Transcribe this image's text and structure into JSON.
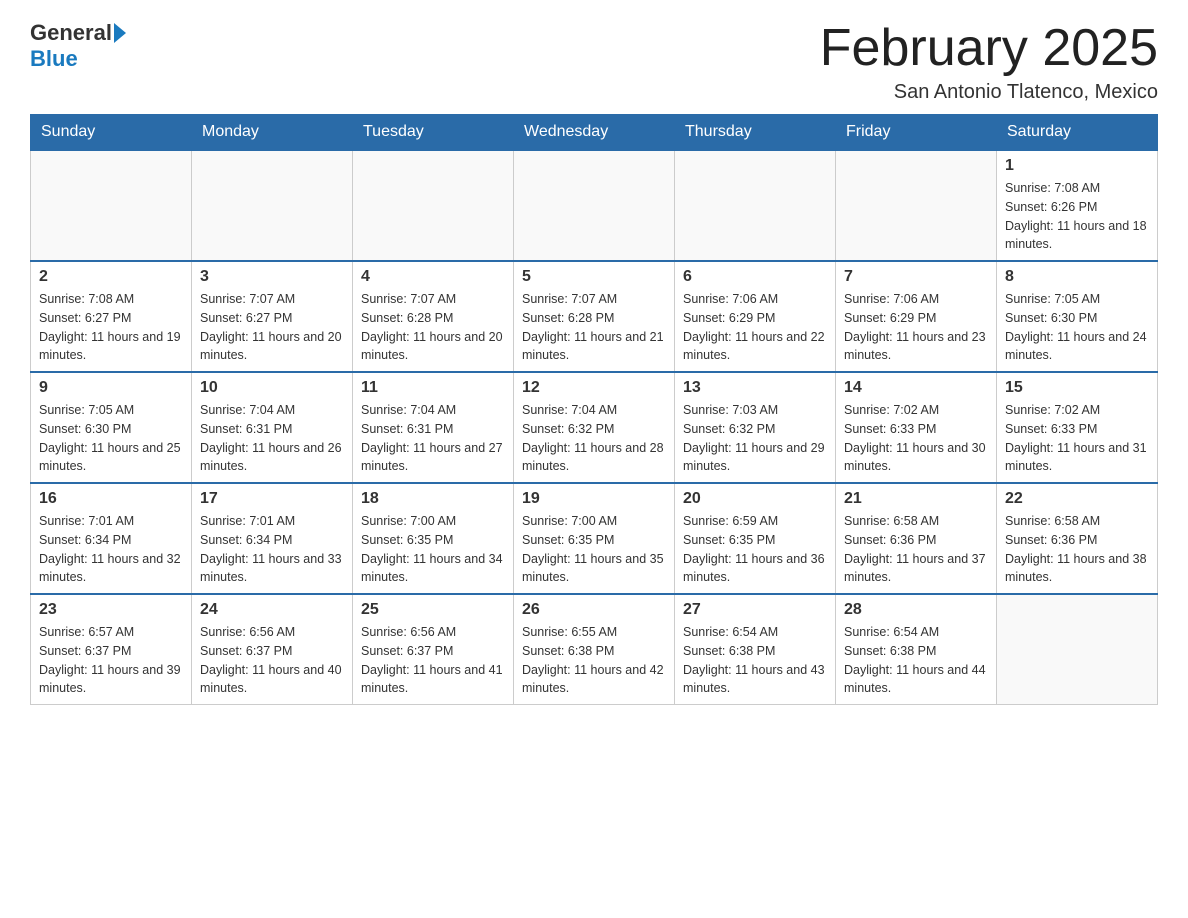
{
  "header": {
    "logo_general": "General",
    "logo_blue": "Blue",
    "month_title": "February 2025",
    "location": "San Antonio Tlatenco, Mexico"
  },
  "days_of_week": [
    "Sunday",
    "Monday",
    "Tuesday",
    "Wednesday",
    "Thursday",
    "Friday",
    "Saturday"
  ],
  "weeks": [
    [
      {
        "num": "",
        "info": ""
      },
      {
        "num": "",
        "info": ""
      },
      {
        "num": "",
        "info": ""
      },
      {
        "num": "",
        "info": ""
      },
      {
        "num": "",
        "info": ""
      },
      {
        "num": "",
        "info": ""
      },
      {
        "num": "1",
        "info": "Sunrise: 7:08 AM\nSunset: 6:26 PM\nDaylight: 11 hours and 18 minutes."
      }
    ],
    [
      {
        "num": "2",
        "info": "Sunrise: 7:08 AM\nSunset: 6:27 PM\nDaylight: 11 hours and 19 minutes."
      },
      {
        "num": "3",
        "info": "Sunrise: 7:07 AM\nSunset: 6:27 PM\nDaylight: 11 hours and 20 minutes."
      },
      {
        "num": "4",
        "info": "Sunrise: 7:07 AM\nSunset: 6:28 PM\nDaylight: 11 hours and 20 minutes."
      },
      {
        "num": "5",
        "info": "Sunrise: 7:07 AM\nSunset: 6:28 PM\nDaylight: 11 hours and 21 minutes."
      },
      {
        "num": "6",
        "info": "Sunrise: 7:06 AM\nSunset: 6:29 PM\nDaylight: 11 hours and 22 minutes."
      },
      {
        "num": "7",
        "info": "Sunrise: 7:06 AM\nSunset: 6:29 PM\nDaylight: 11 hours and 23 minutes."
      },
      {
        "num": "8",
        "info": "Sunrise: 7:05 AM\nSunset: 6:30 PM\nDaylight: 11 hours and 24 minutes."
      }
    ],
    [
      {
        "num": "9",
        "info": "Sunrise: 7:05 AM\nSunset: 6:30 PM\nDaylight: 11 hours and 25 minutes."
      },
      {
        "num": "10",
        "info": "Sunrise: 7:04 AM\nSunset: 6:31 PM\nDaylight: 11 hours and 26 minutes."
      },
      {
        "num": "11",
        "info": "Sunrise: 7:04 AM\nSunset: 6:31 PM\nDaylight: 11 hours and 27 minutes."
      },
      {
        "num": "12",
        "info": "Sunrise: 7:04 AM\nSunset: 6:32 PM\nDaylight: 11 hours and 28 minutes."
      },
      {
        "num": "13",
        "info": "Sunrise: 7:03 AM\nSunset: 6:32 PM\nDaylight: 11 hours and 29 minutes."
      },
      {
        "num": "14",
        "info": "Sunrise: 7:02 AM\nSunset: 6:33 PM\nDaylight: 11 hours and 30 minutes."
      },
      {
        "num": "15",
        "info": "Sunrise: 7:02 AM\nSunset: 6:33 PM\nDaylight: 11 hours and 31 minutes."
      }
    ],
    [
      {
        "num": "16",
        "info": "Sunrise: 7:01 AM\nSunset: 6:34 PM\nDaylight: 11 hours and 32 minutes."
      },
      {
        "num": "17",
        "info": "Sunrise: 7:01 AM\nSunset: 6:34 PM\nDaylight: 11 hours and 33 minutes."
      },
      {
        "num": "18",
        "info": "Sunrise: 7:00 AM\nSunset: 6:35 PM\nDaylight: 11 hours and 34 minutes."
      },
      {
        "num": "19",
        "info": "Sunrise: 7:00 AM\nSunset: 6:35 PM\nDaylight: 11 hours and 35 minutes."
      },
      {
        "num": "20",
        "info": "Sunrise: 6:59 AM\nSunset: 6:35 PM\nDaylight: 11 hours and 36 minutes."
      },
      {
        "num": "21",
        "info": "Sunrise: 6:58 AM\nSunset: 6:36 PM\nDaylight: 11 hours and 37 minutes."
      },
      {
        "num": "22",
        "info": "Sunrise: 6:58 AM\nSunset: 6:36 PM\nDaylight: 11 hours and 38 minutes."
      }
    ],
    [
      {
        "num": "23",
        "info": "Sunrise: 6:57 AM\nSunset: 6:37 PM\nDaylight: 11 hours and 39 minutes."
      },
      {
        "num": "24",
        "info": "Sunrise: 6:56 AM\nSunset: 6:37 PM\nDaylight: 11 hours and 40 minutes."
      },
      {
        "num": "25",
        "info": "Sunrise: 6:56 AM\nSunset: 6:37 PM\nDaylight: 11 hours and 41 minutes."
      },
      {
        "num": "26",
        "info": "Sunrise: 6:55 AM\nSunset: 6:38 PM\nDaylight: 11 hours and 42 minutes."
      },
      {
        "num": "27",
        "info": "Sunrise: 6:54 AM\nSunset: 6:38 PM\nDaylight: 11 hours and 43 minutes."
      },
      {
        "num": "28",
        "info": "Sunrise: 6:54 AM\nSunset: 6:38 PM\nDaylight: 11 hours and 44 minutes."
      },
      {
        "num": "",
        "info": ""
      }
    ]
  ]
}
